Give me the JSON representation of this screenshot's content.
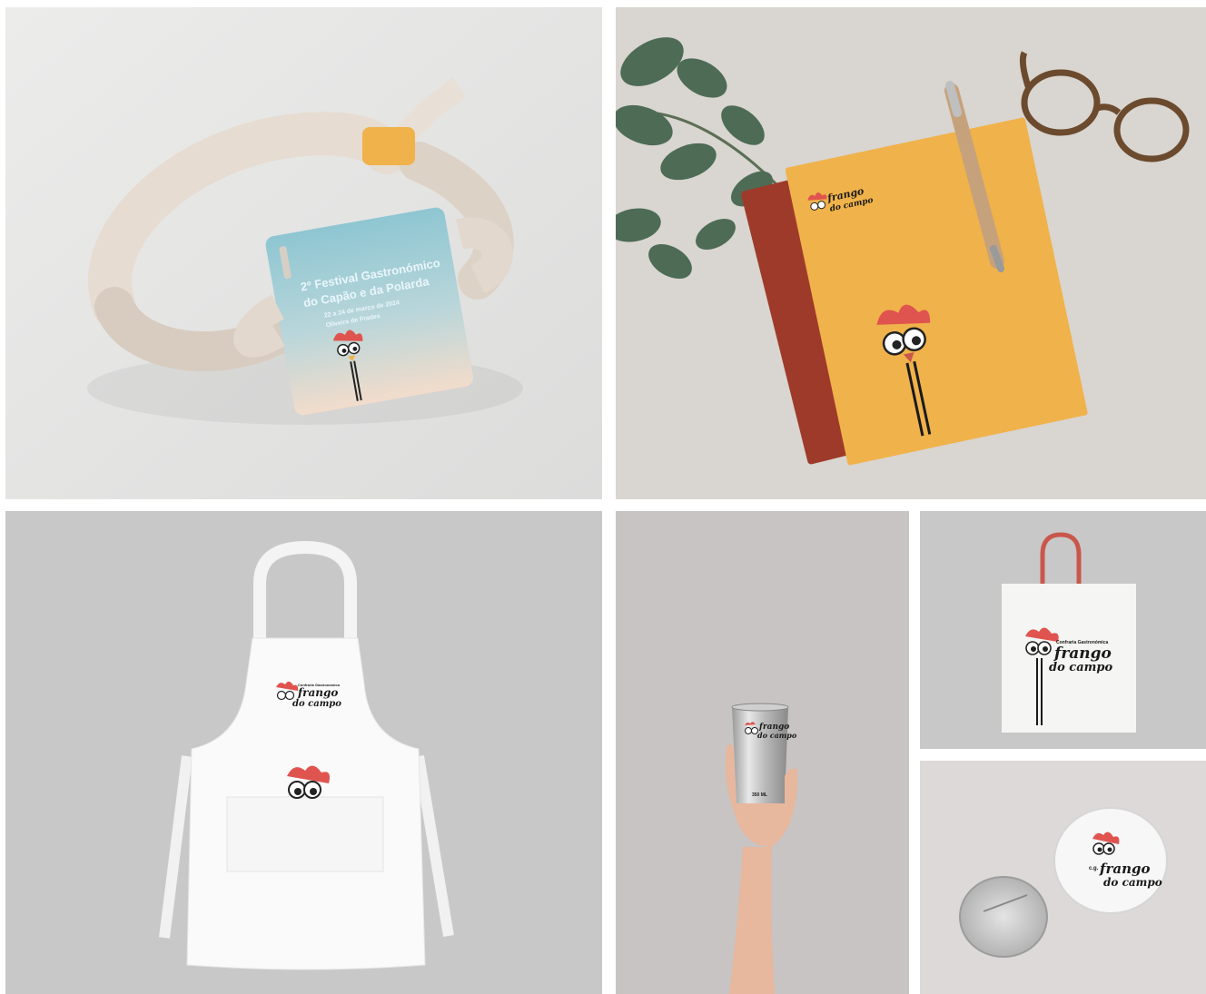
{
  "festival": {
    "title_line1": "2º Festival Gastronómico",
    "title_line2": "do Capão e da Polarda",
    "dates": "22 a 24 de março de 2024",
    "location": "Oliveira de Frades"
  },
  "brand": {
    "tagline": "Confraria Gastronómica",
    "word1": "frango",
    "word2": "do campo",
    "badge_prefix": "c.g."
  },
  "cup": {
    "capacity": "350 ML"
  },
  "colors": {
    "accent_orange": "#f0b24a",
    "cover_red": "#9e3a2a",
    "comb_red": "#e0544f",
    "tote_handle": "#c9574b",
    "background_grey": "#c9c6c6"
  }
}
